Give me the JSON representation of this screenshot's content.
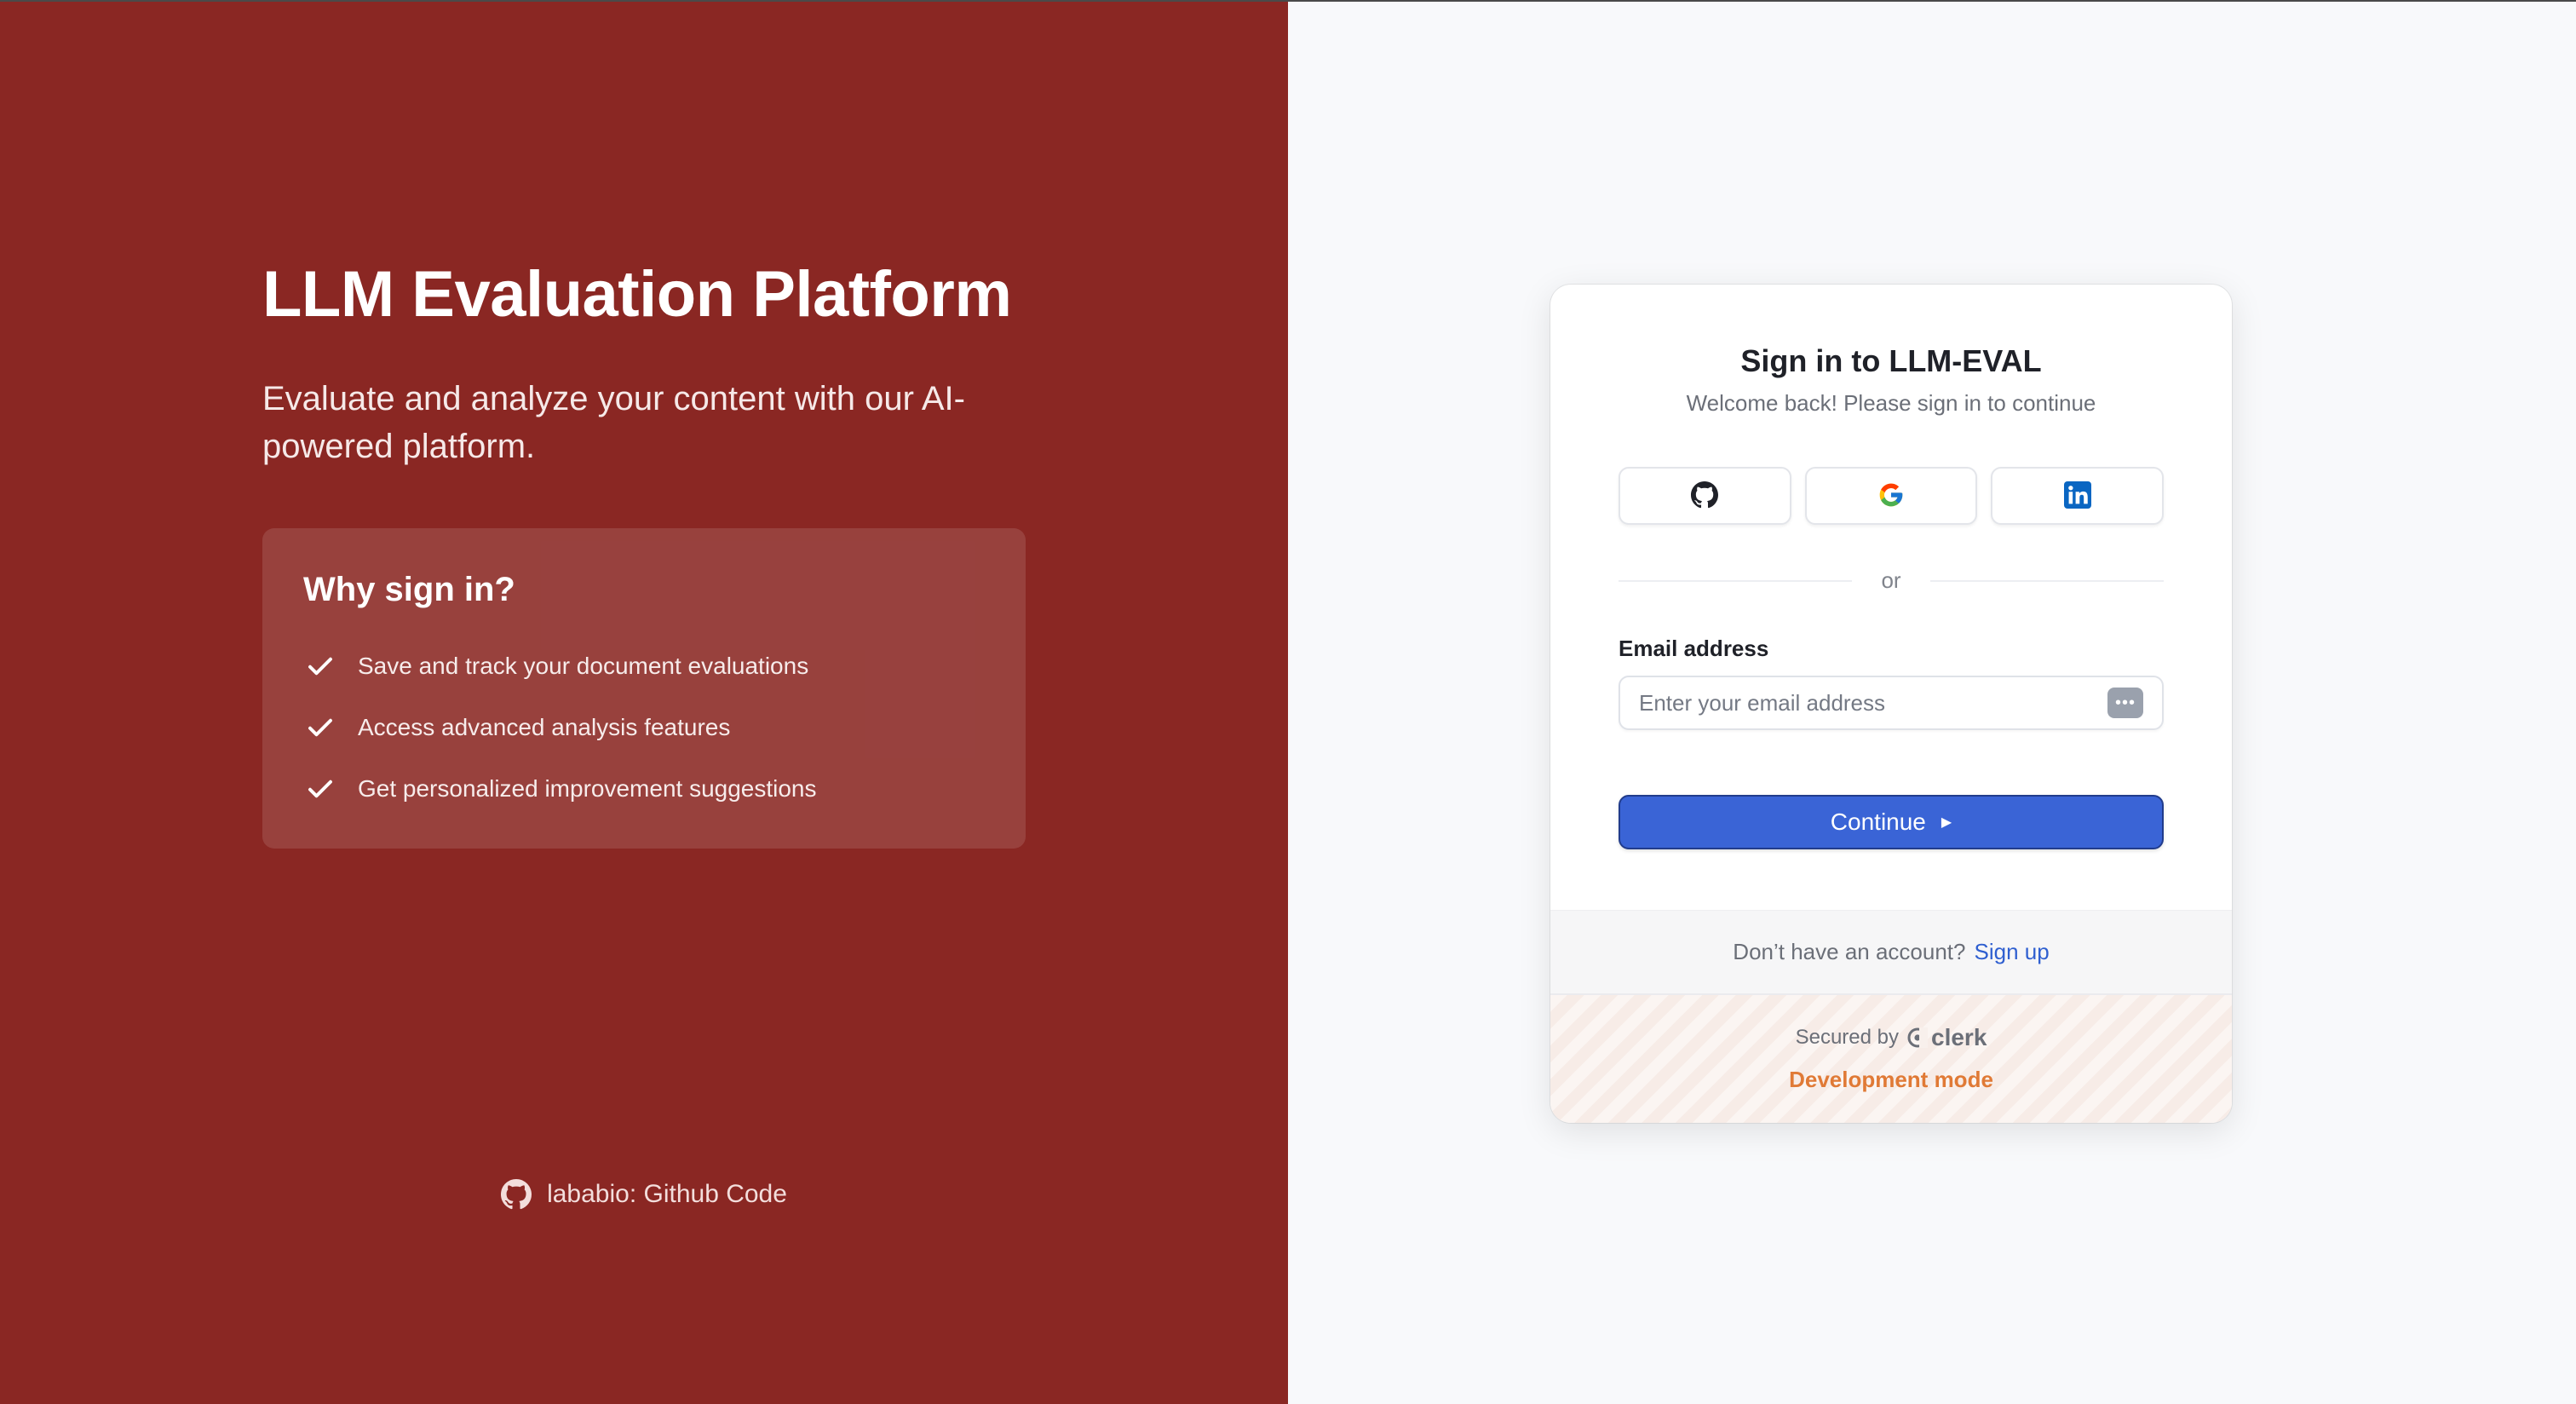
{
  "left_panel": {
    "title": "LLM Evaluation Platform",
    "subtitle": "Evaluate and analyze your content with our AI-powered platform.",
    "why": {
      "title": "Why sign in?",
      "items": [
        "Save and track your document evaluations",
        "Access advanced analysis features",
        "Get personalized improvement suggestions"
      ],
      "check_icon": "check-icon"
    },
    "github_link": {
      "label": "lababio: Github Code",
      "icon": "github-icon"
    },
    "background_color": "#8a2723"
  },
  "signin_card": {
    "title": "Sign in to LLM-EVAL",
    "subtitle": "Welcome back! Please sign in to continue",
    "social_buttons": [
      {
        "provider": "GitHub",
        "icon": "github-icon"
      },
      {
        "provider": "Google",
        "icon": "google-icon"
      },
      {
        "provider": "LinkedIn",
        "icon": "linkedin-icon"
      }
    ],
    "divider_text": "or",
    "email": {
      "label": "Email address",
      "placeholder": "Enter your email address",
      "value": ""
    },
    "continue_label": "Continue",
    "footer": {
      "no_account_text": "Don’t have an account?",
      "signup_label": "Sign up",
      "secured_by": "Secured by",
      "brand": "clerk",
      "dev_mode": "Development mode"
    },
    "accent_color": "#3a64d6"
  }
}
